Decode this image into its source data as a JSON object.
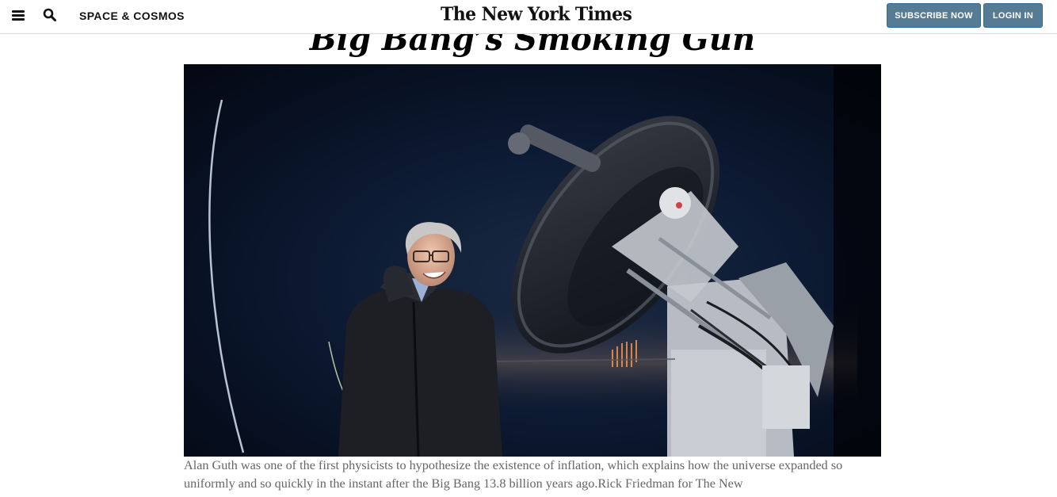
{
  "header": {
    "menu_icon": "hamburger-menu-icon",
    "search_icon": "search-icon",
    "section_label": "SPACE & COSMOS",
    "logo_text": "The New York Times",
    "subscribe_label": "SUBSCRIBE NOW",
    "login_label": "LOGIN IN"
  },
  "article": {
    "headline": "Big Bang’s Smoking Gun",
    "caption": "Alan Guth was one of the first physicists to hypothesize the existence of inflation, which explains how the universe expanded so uniformly and so quickly in the instant after the Big Bang 13.8 billion years ago.",
    "credit": "Rick Friedman for The New"
  },
  "colors": {
    "button_bg": "#567b95",
    "caption_text": "#666666",
    "photo_sky": "#0a1a33"
  }
}
